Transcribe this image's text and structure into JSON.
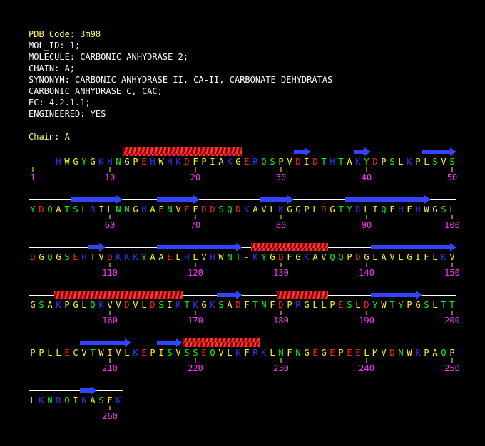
{
  "header": {
    "pdb_code": "PDB Code: 3m98",
    "lines": [
      "MOL_ID: 1;",
      "MOLECULE: CARBONIC ANHYDRASE 2;",
      "CHAIN: A;",
      "SYNONYM: CARBONIC ANHYDRASE II, CA-II, CARBONATE DEHYDRATAS",
      "CARBONIC ANHYDRASE C, CAC;",
      "EC: 4.2.1.1;",
      "ENGINEERED: YES"
    ],
    "chain_label": "Chain: A"
  },
  "colors": {
    "hydrophobic": "#ffff00",
    "polar": "#00ff00",
    "positive": "#3333ff",
    "negative": "#ff2222",
    "special": "#ffffff",
    "gap": "#ffffff",
    "numbers": "#ff33ff",
    "helix": "#ff3333",
    "strand": "#3344ff"
  },
  "rows": [
    {
      "seq": "---HWGYGKHNGPEHWHKDFPIAKGERQSPVDIDTHTAKYDPSLKPLSVS",
      "numbers": [
        {
          "col": 0,
          "label": "1"
        },
        {
          "col": 9,
          "label": "10"
        },
        {
          "col": 19,
          "label": "20"
        },
        {
          "col": 29,
          "label": "30"
        },
        {
          "col": 39,
          "label": "40"
        },
        {
          "col": 49,
          "label": "50"
        }
      ],
      "ss": [
        {
          "type": "helix",
          "start": 11,
          "end": 24
        },
        {
          "type": "strand",
          "start": 31,
          "end": 32
        },
        {
          "type": "strand",
          "start": 38,
          "end": 39
        },
        {
          "type": "strand",
          "start": 46,
          "end": 49
        }
      ]
    },
    {
      "seq": "YDQATSLRILNNGHAFNVEFDDSQDKAVLKGGPLDGTYRLIQFHFHWGSL",
      "numbers": [
        {
          "col": 9,
          "label": "60"
        },
        {
          "col": 19,
          "label": "70"
        },
        {
          "col": 29,
          "label": "80"
        },
        {
          "col": 39,
          "label": "90"
        },
        {
          "col": 49,
          "label": "100"
        }
      ],
      "ss": [
        {
          "type": "strand",
          "start": 5,
          "end": 10
        },
        {
          "type": "strand",
          "start": 15,
          "end": 19
        },
        {
          "type": "strand",
          "start": 27,
          "end": 30
        },
        {
          "type": "strand",
          "start": 37,
          "end": 46
        }
      ]
    },
    {
      "seq": "DGQGSEHTVDKKKYAAELHLVHWNT-KYGDFGKAVQQPDGLAVLGIFLKV",
      "numbers": [
        {
          "col": 9,
          "label": "110"
        },
        {
          "col": 19,
          "label": "120"
        },
        {
          "col": 29,
          "label": "130"
        },
        {
          "col": 39,
          "label": "140"
        },
        {
          "col": 49,
          "label": "150"
        }
      ],
      "ss": [
        {
          "type": "strand",
          "start": 7,
          "end": 8
        },
        {
          "type": "strand",
          "start": 15,
          "end": 24
        },
        {
          "type": "helix",
          "start": 26,
          "end": 34
        },
        {
          "type": "strand",
          "start": 40,
          "end": 49
        }
      ]
    },
    {
      "seq": "GSAKPGLQKVVDVLDSIKTKGKSADFTNFDPRGLLPESLDYWTYPGSLTT",
      "numbers": [
        {
          "col": 9,
          "label": "160"
        },
        {
          "col": 19,
          "label": "170"
        },
        {
          "col": 29,
          "label": "180"
        },
        {
          "col": 39,
          "label": "190"
        },
        {
          "col": 49,
          "label": "200"
        }
      ],
      "ss": [
        {
          "type": "helix",
          "start": 3,
          "end": 17
        },
        {
          "type": "strand",
          "start": 22,
          "end": 24
        },
        {
          "type": "helix",
          "start": 29,
          "end": 34
        },
        {
          "type": "strand",
          "start": 40,
          "end": 45
        }
      ]
    },
    {
      "seq": "PPLLECVTWIVLKEPISVSSEQVLKFRKLNFNGEGEPEELMVDNWRPAQP",
      "numbers": [
        {
          "col": 9,
          "label": "210"
        },
        {
          "col": 19,
          "label": "220"
        },
        {
          "col": 29,
          "label": "230"
        },
        {
          "col": 39,
          "label": "240"
        },
        {
          "col": 49,
          "label": "250"
        }
      ],
      "ss": [
        {
          "type": "strand",
          "start": 6,
          "end": 11
        },
        {
          "type": "strand",
          "start": 15,
          "end": 17
        },
        {
          "type": "helix",
          "start": 18,
          "end": 26
        }
      ]
    },
    {
      "seq": "LKNRQIKASFK",
      "numbers": [
        {
          "col": 9,
          "label": "260"
        }
      ],
      "ss": [
        {
          "type": "strand",
          "start": 6,
          "end": 7
        }
      ]
    }
  ]
}
